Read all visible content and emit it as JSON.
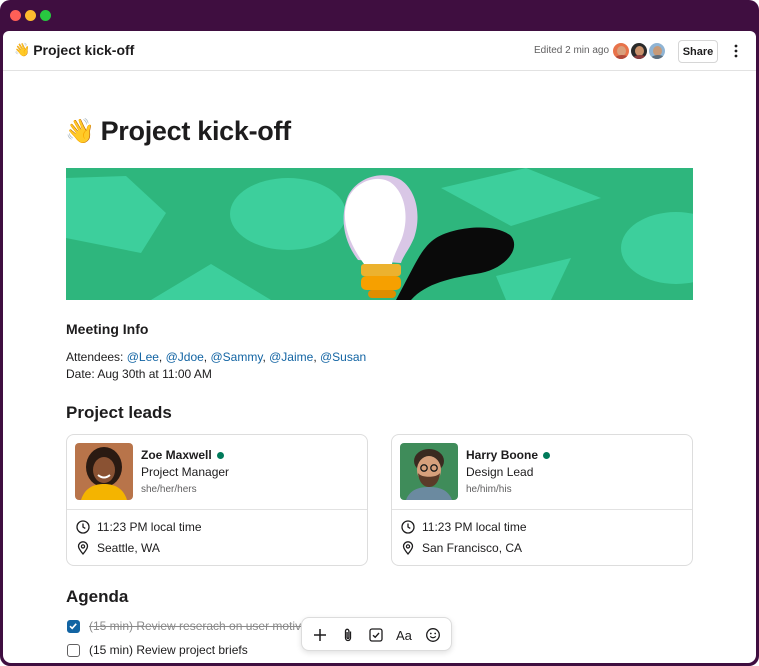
{
  "header": {
    "emoji": "👋",
    "title": "Project kick-off",
    "edited": "Edited 2 min ago",
    "share_label": "Share",
    "icons": [
      "avatar-stack",
      "more-vertical-icon"
    ]
  },
  "document": {
    "emoji": "👋",
    "title": "Project kick-off",
    "banner_colors": {
      "background": "#2eb67d",
      "shapes": "#3dcf9c",
      "bulb": "#ffffff",
      "base": "#fcb400"
    },
    "meeting": {
      "heading": "Meeting Info",
      "attendees_label": "Attendees:",
      "attendees": [
        "@Lee",
        "@Jdoe",
        "@Sammy",
        "@Jaime",
        "@Susan"
      ],
      "date": "Date: Aug 30th at 11:00 AM"
    },
    "leads": {
      "heading": "Project leads",
      "people": [
        {
          "name": "Zoe Maxwell",
          "role": "Project Manager",
          "pronouns": "she/her/hers",
          "local_time": "11:23 PM local time",
          "location": "Seattle, WA",
          "status": "online"
        },
        {
          "name": "Harry Boone",
          "role": "Design Lead",
          "pronouns": "he/him/his",
          "local_time": "11:23 PM local time",
          "location": "San Francisco, CA",
          "status": "online"
        }
      ]
    },
    "agenda": {
      "heading": "Agenda",
      "items": [
        {
          "text": "(15 min) Review reserach on user motivat",
          "checked": true
        },
        {
          "text": "(15 min) Review project briefs",
          "checked": false
        }
      ]
    }
  },
  "toolbar": {
    "tools": [
      "plus-icon",
      "paperclip-icon",
      "checkbox-icon",
      "text-format-icon",
      "emoji-icon"
    ],
    "format_label": "Aa"
  },
  "colors": {
    "window_frame": "#3f0e40",
    "link": "#1264a3",
    "online": "#007a5a",
    "checked": "#1264a3"
  }
}
